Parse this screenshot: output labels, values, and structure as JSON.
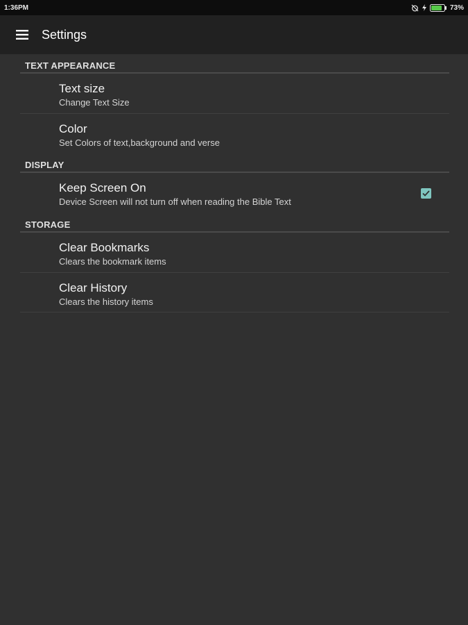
{
  "status_bar": {
    "time": "1:36PM",
    "battery": "73%",
    "icons": [
      "alarm-off-icon",
      "charging-icon",
      "battery-icon"
    ]
  },
  "app_bar": {
    "title": "Settings",
    "menu_icon": "hamburger-menu-icon"
  },
  "sections": [
    {
      "header": "TEXT APPEARANCE",
      "items": [
        {
          "title": "Text size",
          "summary": "Change Text Size"
        },
        {
          "title": "Color",
          "summary": "Set Colors of text,background and verse"
        }
      ]
    },
    {
      "header": "DISPLAY",
      "items": [
        {
          "title": "Keep Screen On",
          "summary": "Device Screen will not turn off when reading the Bible Text",
          "checked": true
        }
      ]
    },
    {
      "header": "STORAGE",
      "items": [
        {
          "title": "Clear Bookmarks",
          "summary": "Clears the bookmark items"
        },
        {
          "title": "Clear History",
          "summary": "Clears the history items"
        }
      ]
    }
  ],
  "colors": {
    "background": "#303030",
    "app_bar": "#212121",
    "status_bar": "#0d0d0d",
    "accent": "#7fc6bf",
    "battery": "#57c94a"
  }
}
